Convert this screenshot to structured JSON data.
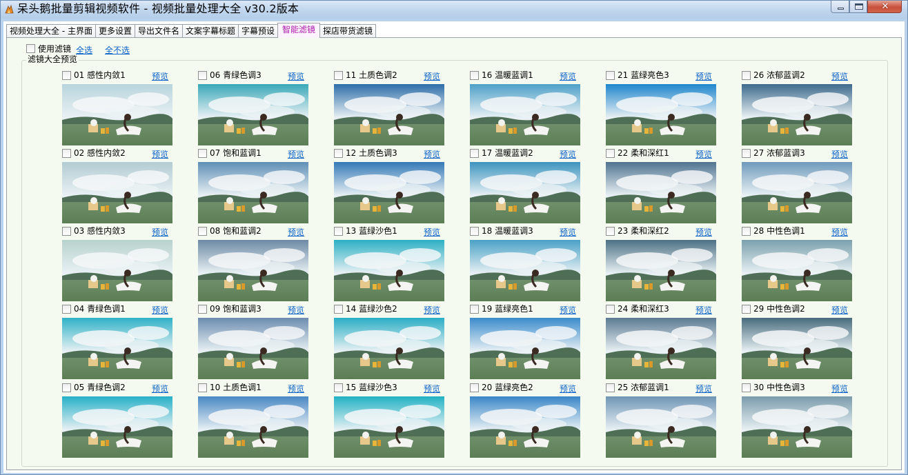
{
  "window": {
    "title": "呆头鹅批量剪辑视频软件 -  视频批量处理大全  v30.2版本",
    "close_glyph": "✕"
  },
  "tabs": [
    {
      "label": "视频处理大全 - 主界面"
    },
    {
      "label": "更多设置"
    },
    {
      "label": "导出文件名"
    },
    {
      "label": "文案字幕标题"
    },
    {
      "label": "字幕预设"
    },
    {
      "label": "智能滤镜",
      "active": true
    },
    {
      "label": "探店带货滤镜"
    }
  ],
  "options": {
    "use_filter_label": "使用滤镜",
    "select_all": "全选",
    "deselect_all": "全不选"
  },
  "filter_group": {
    "title": "滤镜大全预览",
    "preview_label": "预览",
    "filters": [
      {
        "name": "01 感性内敛1",
        "tint": "#b8d4dc"
      },
      {
        "name": "02 感性内敛2",
        "tint": "#b2ccd2"
      },
      {
        "name": "03 感性内敛3",
        "tint": "#b7d2cd"
      },
      {
        "name": "04 青绿色调1",
        "tint": "#2fb1c6"
      },
      {
        "name": "05 青绿色调2",
        "tint": "#27b0c7"
      },
      {
        "name": "06 青绿色调3",
        "tint": "#3aa8b8"
      },
      {
        "name": "07 饱和蓝调1",
        "tint": "#5f8fb6"
      },
      {
        "name": "08 饱和蓝调2",
        "tint": "#6d8aa5"
      },
      {
        "name": "09 饱和蓝调3",
        "tint": "#6c8db0"
      },
      {
        "name": "10 土质色调1",
        "tint": "#4a88c4"
      },
      {
        "name": "11 土质色调2",
        "tint": "#2d6ea8"
      },
      {
        "name": "12 土质色调3",
        "tint": "#3479b7"
      },
      {
        "name": "13 蓝绿沙色1",
        "tint": "#2cb0c4"
      },
      {
        "name": "14 蓝绿沙色2",
        "tint": "#2aaec5"
      },
      {
        "name": "15 蓝绿沙色3",
        "tint": "#21b2c4"
      },
      {
        "name": "16 温暖蓝调1",
        "tint": "#4ea0c8"
      },
      {
        "name": "17 温暖蓝调2",
        "tint": "#3d94bf"
      },
      {
        "name": "18 温暖蓝调3",
        "tint": "#4aa1c6"
      },
      {
        "name": "19 蓝绿亮色1",
        "tint": "#3b8bcc"
      },
      {
        "name": "20 蓝绿亮色2",
        "tint": "#3a87c8"
      },
      {
        "name": "21 蓝绿亮色3",
        "tint": "#1f86cc"
      },
      {
        "name": "22 柔和深红1",
        "tint": "#4f7390"
      },
      {
        "name": "23 柔和深红2",
        "tint": "#4d7185"
      },
      {
        "name": "24 柔和深红3",
        "tint": "#5b7a92"
      },
      {
        "name": "25 浓郁蓝调1",
        "tint": "#6f95b5"
      },
      {
        "name": "26 浓郁蓝调2",
        "tint": "#3d6a8c"
      },
      {
        "name": "27 浓郁蓝调3",
        "tint": "#6f9abb"
      },
      {
        "name": "28 中性色调1",
        "tint": "#7aa0ad"
      },
      {
        "name": "29 中性色调2",
        "tint": "#476b7d"
      },
      {
        "name": "30 中性色调3",
        "tint": "#7a9bab"
      }
    ]
  },
  "colors": {
    "active_tab_text": "#b01ab0",
    "link": "#0b62c9"
  }
}
